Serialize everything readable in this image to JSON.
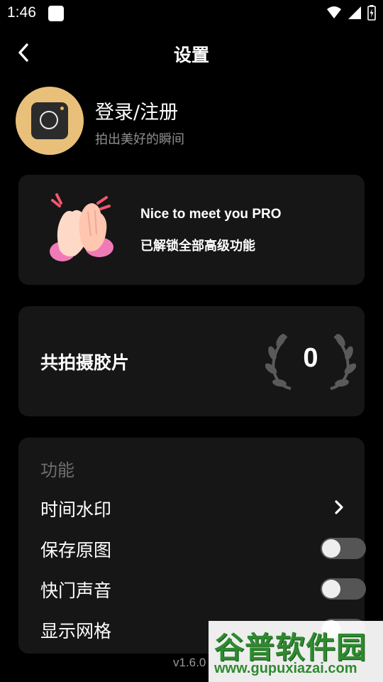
{
  "status_bar": {
    "time": "1:46",
    "icons": [
      "notification-icon",
      "wifi-icon",
      "signal-icon",
      "battery-icon"
    ]
  },
  "header": {
    "title": "设置"
  },
  "profile": {
    "login_label": "登录/注册",
    "subtitle": "拍出美好的瞬间"
  },
  "pro_card": {
    "title": "Nice to meet you PRO",
    "description": "已解锁全部高级功能"
  },
  "count_card": {
    "label": "共拍摄胶片",
    "value": "0"
  },
  "features": {
    "section_title": "功能",
    "items": [
      {
        "label": "时间水印",
        "control": "chevron"
      },
      {
        "label": "保存原图",
        "control": "toggle",
        "on": false
      },
      {
        "label": "快门声音",
        "control": "toggle",
        "on": false
      },
      {
        "label": "显示网格",
        "control": "toggle",
        "on": false
      }
    ]
  },
  "footer": {
    "version": "v1.6.0"
  },
  "watermark": {
    "title": "谷普软件园",
    "url": "www.gupuxiazai.com"
  },
  "colors": {
    "background": "#000000",
    "card": "#161616",
    "avatar": "#e9c07a",
    "toggle_track": "#555555",
    "watermark_green": "#2f8a2f"
  }
}
